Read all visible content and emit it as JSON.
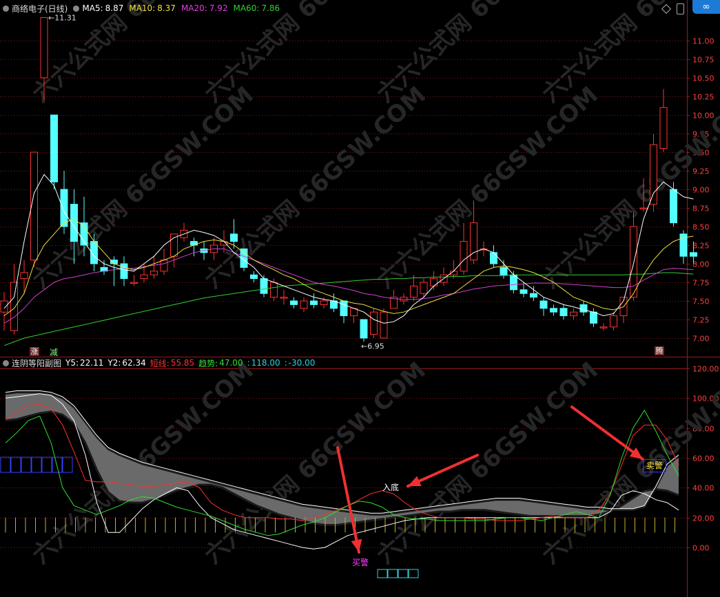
{
  "header": {
    "title": "商络电子(日线)",
    "ma": [
      {
        "label": "MA5:",
        "value": "8.87",
        "color": "#ffffff"
      },
      {
        "label": "MA10:",
        "value": "8.37",
        "color": "#f0e040"
      },
      {
        "label": "MA20:",
        "value": "7.92",
        "color": "#e040e0"
      },
      {
        "label": "MA60:",
        "value": "7.86",
        "color": "#30d030"
      }
    ]
  },
  "indicator": {
    "title": "连阴等阳副图",
    "items": [
      {
        "label": "Y5:",
        "value": "22.11",
        "color": "#ffffff"
      },
      {
        "label": "Y2:",
        "value": "62.34",
        "color": "#ffffff"
      },
      {
        "label": "短线:",
        "value": "55.85",
        "color": "#ff3030"
      },
      {
        "label": "趋势:",
        "value": "47.00",
        "color": "#30e030"
      },
      {
        "label": ":",
        "value": "118.00",
        "color": "#30d0e0"
      },
      {
        "label": ":",
        "value": "-30.00",
        "color": "#30d0e0"
      }
    ]
  },
  "annotations": {
    "high": "11.31",
    "low": "6.95",
    "entry": "入底",
    "buy": "买警",
    "sell": "卖警",
    "zhang": "涨",
    "jian": "减",
    "teng": "腾"
  },
  "watermark": "六六公式网 66GSW.COM",
  "colors": {
    "up": "#ff3232",
    "down": "#54ffff",
    "grid": "#8a1a1a"
  },
  "chart_data": [
    {
      "type": "candlestick",
      "title": "商络电子(日线)",
      "ylim": [
        6.85,
        11.4
      ],
      "yticks": [
        "11.00",
        "10.75",
        "10.50",
        "10.25",
        "10.00",
        "9.75",
        "9.50",
        "9.25",
        "9.00",
        "8.75",
        "8.50",
        "8.25",
        "8.00",
        "7.75",
        "7.50",
        "7.25",
        "7.00"
      ],
      "candles": [
        [
          7.35,
          7.5,
          7.62,
          7.1
        ],
        [
          7.1,
          7.75,
          8.0,
          7.05
        ],
        [
          7.8,
          7.88,
          8.05,
          7.6
        ],
        [
          8.05,
          9.5,
          9.5,
          7.95
        ],
        [
          10.5,
          11.31,
          11.31,
          10.2
        ],
        [
          10.0,
          9.1,
          10.0,
          9.0
        ],
        [
          9.0,
          8.5,
          9.25,
          8.4
        ],
        [
          8.8,
          8.3,
          9.0,
          8.0
        ],
        [
          8.55,
          8.25,
          8.9,
          8.1
        ],
        [
          8.3,
          8.0,
          8.4,
          7.9
        ],
        [
          7.95,
          7.9,
          8.05,
          7.85
        ],
        [
          8.05,
          8.0,
          8.1,
          7.7
        ],
        [
          8.0,
          7.8,
          8.1,
          7.7
        ],
        [
          7.75,
          7.75,
          7.85,
          7.7
        ],
        [
          7.8,
          7.85,
          8.0,
          7.75
        ],
        [
          7.85,
          7.9,
          8.1,
          7.8
        ],
        [
          7.9,
          8.05,
          8.2,
          7.85
        ],
        [
          8.1,
          8.4,
          8.4,
          7.95
        ],
        [
          8.35,
          8.45,
          8.55,
          8.3
        ],
        [
          8.3,
          8.25,
          8.35,
          8.1
        ],
        [
          8.2,
          8.15,
          8.3,
          8.05
        ],
        [
          8.15,
          8.25,
          8.35,
          8.05
        ],
        [
          8.25,
          8.3,
          8.45,
          8.15
        ],
        [
          8.4,
          8.3,
          8.6,
          8.2
        ],
        [
          8.2,
          7.95,
          8.2,
          7.9
        ],
        [
          7.85,
          7.8,
          7.9,
          7.75
        ],
        [
          7.8,
          7.6,
          7.85,
          7.55
        ],
        [
          7.55,
          7.75,
          7.8,
          7.5
        ],
        [
          7.55,
          7.55,
          7.65,
          7.45
        ],
        [
          7.5,
          7.45,
          7.55,
          7.4
        ],
        [
          7.4,
          7.5,
          7.55,
          7.35
        ],
        [
          7.5,
          7.45,
          7.6,
          7.4
        ],
        [
          7.45,
          7.5,
          7.55,
          7.4
        ],
        [
          7.5,
          7.4,
          7.6,
          7.35
        ],
        [
          7.5,
          7.3,
          7.5,
          7.2
        ],
        [
          7.3,
          7.4,
          7.4,
          7.2
        ],
        [
          7.25,
          7.0,
          7.25,
          6.95
        ],
        [
          7.05,
          7.35,
          7.4,
          7.0
        ],
        [
          7.0,
          7.35,
          7.4,
          7.0
        ],
        [
          7.4,
          7.55,
          7.65,
          7.4
        ],
        [
          7.5,
          7.55,
          7.6,
          7.45
        ],
        [
          7.55,
          7.7,
          7.85,
          7.5
        ],
        [
          7.6,
          7.75,
          7.8,
          7.55
        ],
        [
          7.7,
          7.8,
          7.9,
          7.65
        ],
        [
          7.75,
          7.85,
          7.95,
          7.7
        ],
        [
          7.85,
          7.9,
          8.05,
          7.8
        ],
        [
          7.9,
          8.3,
          8.55,
          7.85
        ],
        [
          8.05,
          8.55,
          8.85,
          8.0
        ],
        [
          8.2,
          8.2,
          8.3,
          8.1
        ],
        [
          8.15,
          8.0,
          8.25,
          7.95
        ],
        [
          7.95,
          7.85,
          8.05,
          7.8
        ],
        [
          7.85,
          7.65,
          7.9,
          7.6
        ],
        [
          7.65,
          7.6,
          7.75,
          7.55
        ],
        [
          7.6,
          7.55,
          7.7,
          7.5
        ],
        [
          7.5,
          7.4,
          7.55,
          7.3
        ],
        [
          7.4,
          7.35,
          7.45,
          7.3
        ],
        [
          7.4,
          7.3,
          7.45,
          7.25
        ],
        [
          7.3,
          7.35,
          7.4,
          7.25
        ],
        [
          7.45,
          7.35,
          7.5,
          7.3
        ],
        [
          7.35,
          7.2,
          7.4,
          7.15
        ],
        [
          7.15,
          7.15,
          7.2,
          7.1
        ],
        [
          7.15,
          7.3,
          7.35,
          7.1
        ],
        [
          7.3,
          7.55,
          7.55,
          7.2
        ],
        [
          7.55,
          8.5,
          8.7,
          7.5
        ],
        [
          8.75,
          8.75,
          9.15,
          8.7
        ],
        [
          8.8,
          9.6,
          9.75,
          8.7
        ],
        [
          9.55,
          10.1,
          10.35,
          9.5
        ],
        [
          9.0,
          8.55,
          9.1,
          8.5
        ],
        [
          8.4,
          8.1,
          8.45,
          8.0
        ],
        [
          8.15,
          8.1,
          8.3,
          8.0
        ]
      ],
      "ma5": [
        7.4,
        7.55,
        8.3,
        8.95,
        9.2,
        9.05,
        8.7,
        8.5,
        8.3,
        8.1,
        8.0,
        7.95,
        7.92,
        7.9,
        8.0,
        8.1,
        8.25,
        8.35,
        8.4,
        8.45,
        8.42,
        8.38,
        8.3,
        8.15,
        8.05,
        7.95,
        7.8,
        7.75,
        7.7,
        7.65,
        7.6,
        7.55,
        7.52,
        7.5,
        7.45,
        7.4,
        7.35,
        7.25,
        7.2,
        7.22,
        7.3,
        7.45,
        7.55,
        7.7,
        7.8,
        7.9,
        8.05,
        8.15,
        8.2,
        8.15,
        8.0,
        7.85,
        7.75,
        7.65,
        7.55,
        7.5,
        7.45,
        7.42,
        7.38,
        7.35,
        7.3,
        7.33,
        7.5,
        8.0,
        8.6,
        8.95,
        9.1,
        9.0,
        8.9,
        8.87
      ],
      "ma10": [
        7.3,
        7.4,
        7.6,
        8.0,
        8.25,
        8.4,
        8.55,
        8.6,
        8.5,
        8.3,
        8.15,
        8.0,
        7.95,
        7.92,
        7.95,
        8.0,
        8.05,
        8.1,
        8.2,
        8.25,
        8.3,
        8.32,
        8.3,
        8.25,
        8.15,
        8.05,
        7.98,
        7.92,
        7.85,
        7.8,
        7.72,
        7.65,
        7.6,
        7.55,
        7.5,
        7.47,
        7.45,
        7.4,
        7.36,
        7.33,
        7.35,
        7.4,
        7.45,
        7.5,
        7.55,
        7.6,
        7.7,
        7.8,
        7.9,
        7.95,
        7.97,
        7.95,
        7.92,
        7.88,
        7.82,
        7.75,
        7.65,
        7.55,
        7.5,
        7.45,
        7.4,
        7.38,
        7.42,
        7.6,
        7.85,
        8.05,
        8.2,
        8.3,
        8.35,
        8.37
      ],
      "ma20": [
        7.2,
        7.28,
        7.4,
        7.55,
        7.65,
        7.75,
        7.8,
        7.82,
        7.85,
        7.88,
        7.9,
        7.92,
        7.93,
        7.94,
        7.96,
        7.98,
        8.0,
        8.05,
        8.1,
        8.15,
        8.18,
        8.2,
        8.2,
        8.15,
        8.1,
        8.05,
        8.0,
        7.95,
        7.9,
        7.85,
        7.8,
        7.75,
        7.72,
        7.7,
        7.67,
        7.64,
        7.6,
        7.58,
        7.55,
        7.53,
        7.52,
        7.52,
        7.53,
        7.55,
        7.58,
        7.6,
        7.63,
        7.66,
        7.68,
        7.7,
        7.71,
        7.72,
        7.73,
        7.74,
        7.74,
        7.74,
        7.73,
        7.72,
        7.71,
        7.7,
        7.69,
        7.68,
        7.68,
        7.7,
        7.78,
        7.85,
        7.92,
        7.94,
        7.93,
        7.92
      ],
      "ma60": [
        6.9,
        6.95,
        7.0,
        7.03,
        7.06,
        7.09,
        7.12,
        7.15,
        7.18,
        7.21,
        7.24,
        7.27,
        7.3,
        7.33,
        7.36,
        7.39,
        7.42,
        7.45,
        7.48,
        7.51,
        7.54,
        7.56,
        7.58,
        7.6,
        7.62,
        7.64,
        7.66,
        7.68,
        7.7,
        7.71,
        7.72,
        7.73,
        7.74,
        7.75,
        7.76,
        7.77,
        7.78,
        7.79,
        7.79,
        7.8,
        7.8,
        7.81,
        7.81,
        7.82,
        7.82,
        7.83,
        7.83,
        7.84,
        7.84,
        7.84,
        7.84,
        7.85,
        7.85,
        7.85,
        7.85,
        7.85,
        7.85,
        7.85,
        7.85,
        7.85,
        7.85,
        7.85,
        7.85,
        7.86,
        7.86,
        7.87,
        7.88,
        7.88,
        7.87,
        7.86
      ]
    },
    {
      "type": "line",
      "title": "连阴等阳副图",
      "ylim": [
        -10,
        125
      ],
      "yticks": [
        "120.00",
        "100.00",
        "80.00",
        "60.00",
        "40.00",
        "20.00",
        "0.00"
      ],
      "band_upper": [
        103,
        104,
        104,
        104,
        103,
        100,
        94,
        84,
        74,
        66,
        62,
        59,
        56,
        54,
        52,
        50,
        48,
        46,
        44,
        42,
        40,
        38,
        36,
        34,
        32,
        30,
        28,
        27,
        26,
        25,
        24,
        23,
        22,
        22,
        23,
        24,
        25,
        26,
        27,
        28,
        29,
        30,
        31,
        32,
        32,
        32,
        31,
        30,
        29,
        28,
        27,
        26,
        26,
        25,
        25,
        25,
        27,
        40,
        55,
        61
      ],
      "band_lower": [
        85,
        86,
        88,
        90,
        91,
        89,
        83,
        70,
        52,
        37,
        31,
        30,
        30,
        32,
        35,
        38,
        40,
        42,
        42,
        40,
        36,
        32,
        28,
        25,
        22,
        20,
        18,
        16,
        15,
        15,
        16,
        17,
        18,
        19,
        20,
        21,
        22,
        23,
        24,
        24,
        25,
        25,
        25,
        24,
        23,
        22,
        21,
        21,
        21,
        21,
        21,
        21,
        22,
        24,
        28,
        33,
        38,
        39,
        38,
        35
      ],
      "white_line": [
        100,
        101,
        102,
        103,
        102,
        96,
        85,
        62,
        30,
        10,
        10,
        18,
        26,
        32,
        36,
        40,
        38,
        28,
        20,
        16,
        12,
        10,
        8,
        6,
        4,
        2,
        0,
        -1,
        0,
        4,
        8,
        10,
        12,
        14,
        16,
        18,
        19,
        20,
        20,
        20,
        20,
        20,
        20,
        20,
        20,
        20,
        20,
        20,
        20,
        20,
        20,
        20,
        20,
        24,
        35,
        38,
        36,
        32,
        30,
        25
      ],
      "red_line": [
        86,
        90,
        95,
        96,
        93,
        82,
        64,
        45,
        44,
        44,
        43,
        42,
        41,
        41,
        42,
        43,
        44,
        40,
        30,
        25,
        22,
        20,
        20,
        20,
        19,
        19,
        18,
        20,
        22,
        25,
        28,
        32,
        36,
        38,
        36,
        30,
        25,
        22,
        20,
        20,
        20,
        19,
        19,
        18,
        18,
        18,
        19,
        20,
        21,
        20,
        20,
        20,
        25,
        36,
        55,
        75,
        82,
        82,
        72,
        55
      ],
      "green_line": [
        70,
        77,
        85,
        88,
        70,
        40,
        28,
        25,
        22,
        25,
        28,
        32,
        34,
        33,
        30,
        27,
        25,
        23,
        21,
        18,
        15,
        12,
        10,
        8,
        9,
        12,
        15,
        17,
        20,
        24,
        28,
        31,
        30,
        27,
        22,
        20,
        19,
        19,
        18,
        18,
        18,
        18,
        18,
        19,
        20,
        20,
        19,
        18,
        20,
        22,
        24,
        22,
        20,
        35,
        60,
        80,
        92,
        78,
        62,
        48
      ]
    }
  ]
}
